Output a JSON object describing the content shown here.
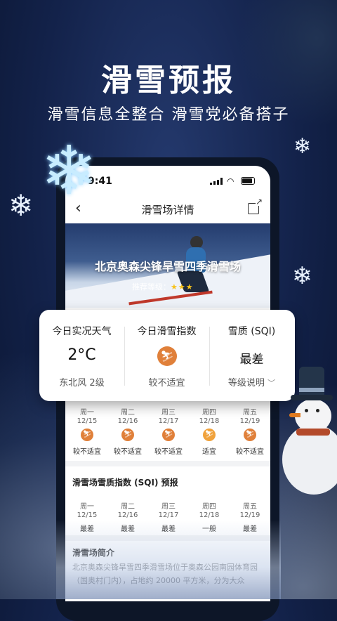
{
  "hero": {
    "title": "滑雪预报",
    "subtitle": "滑雪信息全整合 滑雪党必备搭子"
  },
  "status_bar": {
    "time": "9:41"
  },
  "nav": {
    "title": "滑雪场详情"
  },
  "banner": {
    "resort_name": "北京奥森尖锋旱雪四季滑雪场",
    "rating_label": "推荐等级",
    "rating_stars": 3
  },
  "card": {
    "weather_label": "今日实况天气",
    "temperature": "2°C",
    "wind": "东北风 2级",
    "ski_index_label": "今日滑雪指数",
    "ski_index_value": "较不适宜",
    "sqi_label": "雪质 (SQI)",
    "sqi_value": "最差",
    "sqi_explain": "等级说明"
  },
  "forecast": [
    {
      "day": "周一",
      "date": "12/15",
      "status": "较不适宜",
      "level": "poor"
    },
    {
      "day": "周二",
      "date": "12/16",
      "status": "较不适宜",
      "level": "poor"
    },
    {
      "day": "周三",
      "date": "12/17",
      "status": "较不适宜",
      "level": "poor"
    },
    {
      "day": "周四",
      "date": "12/18",
      "status": "适宜",
      "level": "ok"
    },
    {
      "day": "周五",
      "date": "12/19",
      "status": "较不适宜",
      "level": "poor"
    }
  ],
  "sqi_section": {
    "title": "滑雪场雪质指数 (SQI) 预报",
    "days": [
      {
        "day": "周一",
        "date": "12/15",
        "value": "最差"
      },
      {
        "day": "周二",
        "date": "12/16",
        "value": "最差"
      },
      {
        "day": "周三",
        "date": "12/17",
        "value": "最差"
      },
      {
        "day": "周四",
        "date": "12/18",
        "value": "一般"
      },
      {
        "day": "周五",
        "date": "12/19",
        "value": "最差"
      }
    ]
  },
  "intro": {
    "title": "滑雪场简介",
    "text": "北京奥森尖锋旱雪四季滑雪场位于奥森公园南园体育园（国奥村门内），占地约 20000 平方米，分为大众"
  },
  "colors": {
    "background": "#13224a",
    "accent_orange": "#e0803a",
    "star": "#f7c21c"
  }
}
